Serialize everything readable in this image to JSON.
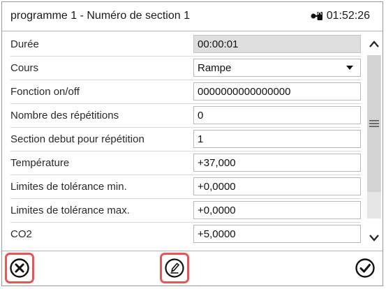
{
  "header": {
    "title": "programme 1 - Numéro de section 1",
    "time": "01:52:26",
    "lock_icon": "lock-key-icon"
  },
  "rows": [
    {
      "label": "Durée",
      "value": "00:00:01",
      "kind": "readonly"
    },
    {
      "label": "Cours",
      "value": "Rampe",
      "kind": "select"
    },
    {
      "label": "Fonction on/off",
      "value": "0000000000000000",
      "kind": "input"
    },
    {
      "label": "Nombre des répétitions",
      "value": "0",
      "kind": "input"
    },
    {
      "label": "Section debut pour répétition",
      "value": "1",
      "kind": "input"
    },
    {
      "label": "Température",
      "value": "+37,000",
      "kind": "input"
    },
    {
      "label": "Limites de tolérance min.",
      "value": "+0,0000",
      "kind": "input"
    },
    {
      "label": "Limites de tolérance max.",
      "value": "+0,0000",
      "kind": "input"
    },
    {
      "label": "CO2",
      "value": "+5,0000",
      "kind": "input"
    }
  ],
  "footer": {
    "cancel_icon": "cancel-circle-icon",
    "edit_icon": "edit-pencil-icon",
    "ok_icon": "confirm-check-icon"
  },
  "colors": {
    "highlight": "#e85555",
    "readonly_bg": "#dedede",
    "scroll_track": "#e6e6e6"
  }
}
